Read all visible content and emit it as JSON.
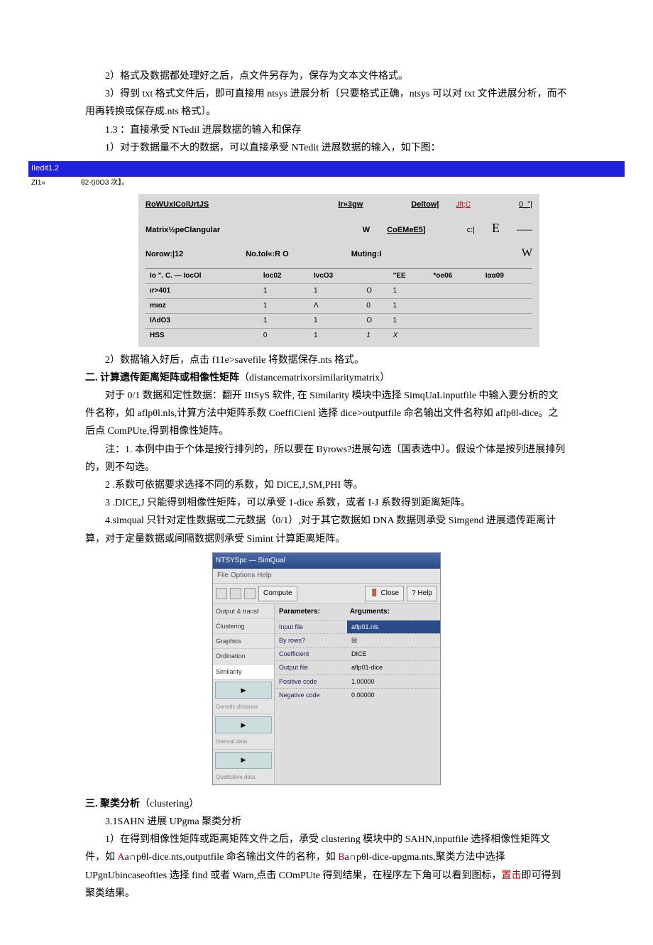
{
  "p": {
    "p1": "2）格式及数据都处理好之后，点文件另存为，保存为文本文件格式。",
    "p2": "3）得到 txt 格式文件后，即可直接用 ntsys 进展分析〔只要格式正确，ntsys 可以对 txt 文件进展分析，而不用再转换或保存成.nts 格式〕。",
    "p3": "1.3 ：直接承受 NTedil 进展数据的输入和保存",
    "p4": "1）对于数据量不大的数据，可以直接承受 NTedit 进展数据的输入，如下图：",
    "p5": "2）数据输入好后，点击 f11e>savefile 将数据保存.nts 格式。",
    "h2a": "二. 计算遗传距离矩阵或相像性矩阵",
    "h2a_sub": "（distancematrixorsimilaritymatrix）",
    "p6": "对于 0/1 数据和定性数据：翻开 IItSyS 软件, 在 Similarity 模块中选择 SimqUaLinputfile 中输入要分析的文件名称，如 aflpθl.nls,计算方法中矩阵系数 CoeffiCienl 选择 dice>outputfile 命名输出文件名称如 aflpθl-dice。之后点 ComPUte,得到相像性矩阵。",
    "p7": "注：1. 本例中由于个体是按行排列的，所以要在 Byrows?进展勾选〔国表选中〕。假设个体是按列进展排列的，则不勾选。",
    "p8": "2 .系数可依据要求选择不同的系数，如 DlCE,J,SM,PHI 等。",
    "p9": "3 .DICE,J 只能得到相像性矩阵，可以承受 1-dice 系数，或者 I-J 系数得到距离矩阵。",
    "p10": "4.simqual 只针对定性数据或二元数据（0/1）,对于其它数据如 DNA 数据则承受 Simgend 进展遗传距离计算，对于定量数据或间隔数据则承受 Simint 计算距离矩阵。",
    "h3a": "三. 聚类分析",
    "h3a_sub": "（clustering）",
    "p11": "3.1SAHN 进展 UPgma 聚类分析",
    "p12a": "1）在得到相像性矩阵或距离矩阵文件之后，承受 clustering 模块中的 SAHN,inputfile 选择相像性矩阵文件，如 ",
    "p12b": "A",
    "p12c": "a∩pθl-dice.nts,outputfile 命名输出文件的名称，如 ",
    "p12d": "B",
    "p12e": "a∩pθl-dice-upgma.nts,聚类方法中选择 UPgnUbincaseofties 选择 find 或者 Warn,点击 COmPUte 得到结果，在程序左下角可以看到图标，",
    "p12f": "置击",
    "p12g": "即可得到聚类结果。"
  },
  "ntedit": {
    "title": "IIedit1.2",
    "pre_a": "ZI1«",
    "pre_b": "θ2-t)0O3 次】。",
    "row1_a": "RoWUxIColUrtJS",
    "row1_b": "Ir»3gw",
    "row1_c": "Deltow|",
    "row1_d": "Jft;C",
    "row1_e": "0_\"|",
    "row2_a": "Matrix½peClangular",
    "row2_b": "W",
    "row2_c": "CoEMeE5]",
    "row2_d": "c:|",
    "row2_e": "E",
    "row2_f": "——",
    "row3_a": "Norow:|12",
    "row3_b": "No.tol«:R O",
    "row3_c": "Muting:I",
    "row3_d": "W",
    "table": {
      "head": [
        "Io \".  C.  —  IocOl",
        "loc02",
        "IvcO3",
        "",
        "\"EE",
        "*oe06",
        "Iαα09"
      ],
      "rows": [
        [
          "ιr>401",
          "1",
          "1",
          "O",
          "1",
          "",
          "",
          ""
        ],
        [
          "mιoz",
          "1",
          "Λ",
          "0",
          "1",
          "",
          "",
          ""
        ],
        [
          "IΛdO3",
          "1",
          "1",
          "O",
          "1",
          "",
          "",
          ""
        ],
        [
          "HSS",
          "0",
          "1",
          "1",
          "X",
          "",
          "",
          ""
        ]
      ]
    }
  },
  "simqual": {
    "title": "NTSYSpc — SimQual",
    "menu": "File  Options  Help",
    "btn_compute": "Compute",
    "btn_close": "Close",
    "btn_help": "Help",
    "left": [
      "Output & transf",
      "Clustering",
      "Graphics",
      "Ordination",
      "Similarity"
    ],
    "left_icons": [
      "Genetic distance",
      "Interval data",
      "Qualitative data"
    ],
    "hdr_a": "Parameters:",
    "hdr_b": "Arguments:",
    "rows": [
      {
        "k": "Input file",
        "v": "aflp01.nls",
        "sel": true
      },
      {
        "k": "By rows?",
        "v": "☒"
      },
      {
        "k": "Coefficient",
        "v": "DICE"
      },
      {
        "k": "Output file",
        "v": "aflp01-dice"
      },
      {
        "k": "Positive code",
        "v": "1.00000"
      },
      {
        "k": "Negative code",
        "v": "0.00000"
      }
    ]
  }
}
